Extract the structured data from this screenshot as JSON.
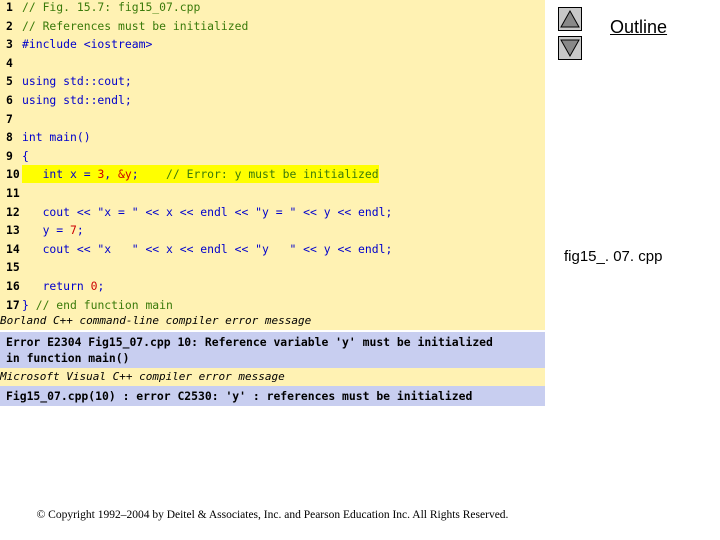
{
  "code": {
    "lines": [
      {
        "num": "1",
        "segs": [
          {
            "t": "// Fig. 15.7: fig15_07.cpp",
            "c": "c-comment"
          }
        ]
      },
      {
        "num": "2",
        "segs": [
          {
            "t": "// References must be initialized",
            "c": "c-comment"
          }
        ]
      },
      {
        "num": "3",
        "segs": [
          {
            "t": "#include <iostream>",
            "c": "c-plain"
          }
        ]
      },
      {
        "num": "4",
        "segs": []
      },
      {
        "num": "5",
        "segs": [
          {
            "t": "using std::cout;",
            "c": "c-kw"
          }
        ]
      },
      {
        "num": "6",
        "segs": [
          {
            "t": "using std::endl;",
            "c": "c-kw"
          }
        ]
      },
      {
        "num": "7",
        "segs": []
      },
      {
        "num": "8",
        "segs": [
          {
            "t": "int main()",
            "c": "c-kw"
          }
        ]
      },
      {
        "num": "9",
        "segs": [
          {
            "t": "{",
            "c": "c-plain"
          }
        ]
      },
      {
        "num": "10",
        "highlight": true,
        "segs": [
          {
            "t": "   int x = ",
            "c": "c-kw"
          },
          {
            "t": "3",
            "c": "c-num"
          },
          {
            "t": ", ",
            "c": "c-kw"
          },
          {
            "t": "&y",
            "c": "c-num"
          },
          {
            "t": ";    ",
            "c": "c-kw"
          },
          {
            "t": "// Error: y must be initialized",
            "c": "c-comment"
          }
        ]
      },
      {
        "num": "11",
        "segs": []
      },
      {
        "num": "12",
        "segs": [
          {
            "t": "   cout << \"x = \" << x << endl << \"y = \" << y << endl;",
            "c": "c-plain"
          }
        ]
      },
      {
        "num": "13",
        "segs": [
          {
            "t": "   y = ",
            "c": "c-plain"
          },
          {
            "t": "7",
            "c": "c-num"
          },
          {
            "t": ";",
            "c": "c-plain"
          }
        ]
      },
      {
        "num": "14",
        "segs": [
          {
            "t": "   cout << \"x   \" << x << endl << \"y   \" << y << endl;",
            "c": "c-plain"
          }
        ]
      },
      {
        "num": "15",
        "segs": []
      },
      {
        "num": "16",
        "segs": [
          {
            "t": "   return ",
            "c": "c-kw"
          },
          {
            "t": "0",
            "c": "c-num"
          },
          {
            "t": ";",
            "c": "c-plain"
          }
        ]
      },
      {
        "num": "17",
        "segs": [
          {
            "t": "} ",
            "c": "c-plain"
          },
          {
            "t": "// end function main",
            "c": "c-comment"
          }
        ]
      }
    ]
  },
  "errors": {
    "borland_label": "Borland C++ command-line compiler error message",
    "borland_message": "Error E2304 Fig15_07.cpp 10: Reference variable 'y' must be initialized\nin function main()",
    "msvc_label": "Microsoft Visual C++ compiler error message",
    "msvc_message": "Fig15_07.cpp(10) : error C2530: 'y' : references must be initialized"
  },
  "sidebar": {
    "outline_label": "Outline",
    "file_name": "fig15_. 07. cpp",
    "up_icon": "triangle-up-icon",
    "down_icon": "triangle-down-icon"
  },
  "footer": {
    "copyright": "© Copyright 1992–2004 by Deitel & Associates, Inc. and Pearson Education Inc. All Rights Reserved."
  },
  "colors": {
    "code_background": "#fff2b3",
    "error_background": "#c8cef0",
    "highlight": "#ffff00",
    "comment": "#3a7a0a",
    "keyword": "#0000cc",
    "number": "#cc0000"
  }
}
